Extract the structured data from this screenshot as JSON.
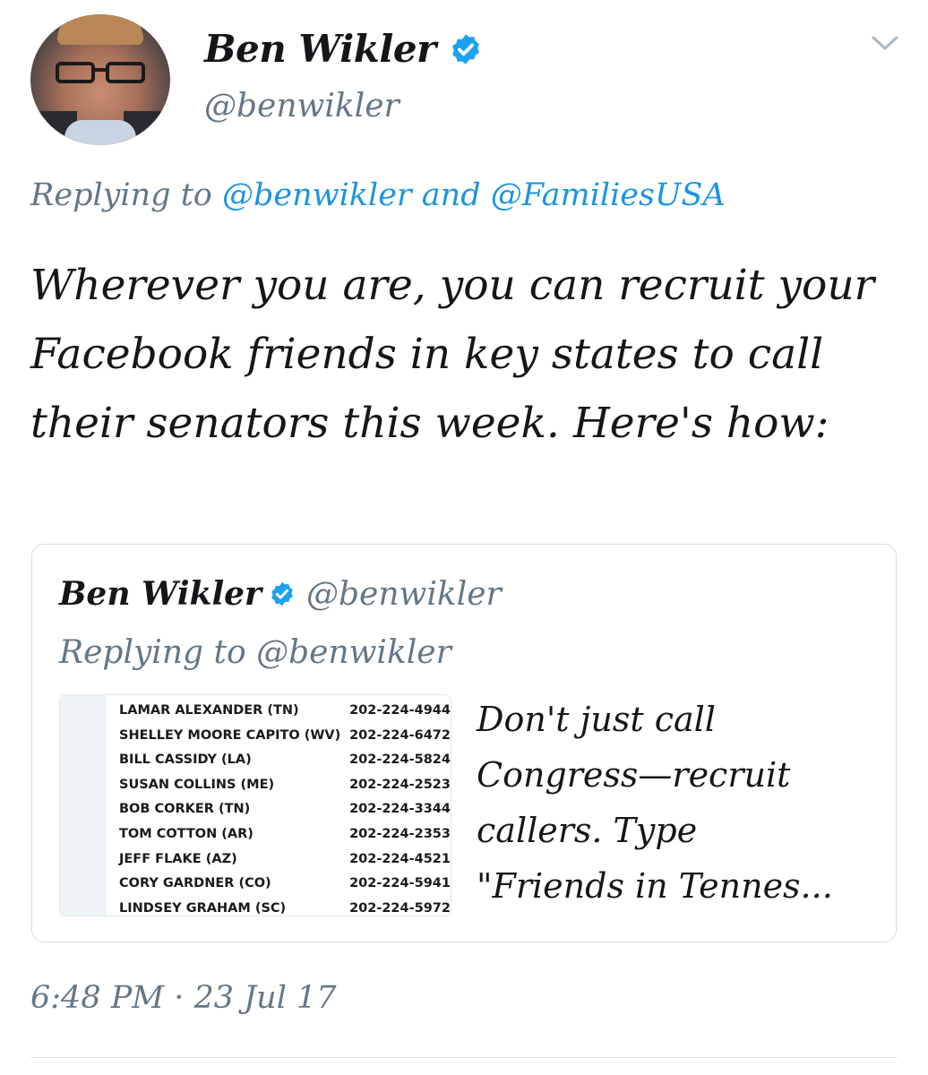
{
  "author": {
    "display_name": "Ben Wikler",
    "handle": "@benwikler"
  },
  "reply_context": {
    "prefix": "Replying to",
    "user1": "@benwikler",
    "and": "and",
    "user2": "@FamiliesUSA"
  },
  "tweet_text": "Wherever you are, you can recruit your Facebook friends in key states to call their senators this week. Here's how:",
  "quoted_tweet": {
    "display_name": "Ben Wikler",
    "handle": "@benwikler",
    "replying": "Replying to @benwikler",
    "text_lines": [
      "Don't just call",
      "Congress—recruit",
      "callers. Type",
      "\"Friends in Tennes..."
    ],
    "image_rows": [
      {
        "name": "LAMAR ALEXANDER (TN)",
        "phone": "202-224-4944"
      },
      {
        "name": "SHELLEY MOORE CAPITO (WV)",
        "phone": "202-224-6472"
      },
      {
        "name": "BILL CASSIDY (LA)",
        "phone": "202-224-5824"
      },
      {
        "name": "SUSAN COLLINS (ME)",
        "phone": "202-224-2523"
      },
      {
        "name": "BOB CORKER (TN)",
        "phone": "202-224-3344"
      },
      {
        "name": "TOM COTTON (AR)",
        "phone": "202-224-2353"
      },
      {
        "name": "JEFF FLAKE (AZ)",
        "phone": "202-224-4521"
      },
      {
        "name": "CORY GARDNER (CO)",
        "phone": "202-224-5941"
      },
      {
        "name": "LINDSEY GRAHAM (SC)",
        "phone": "202-224-5972"
      }
    ]
  },
  "timestamp": "6:48 PM · 23 Jul 17",
  "icons": {
    "verified": "verified-badge-icon",
    "menu": "chevron-down-icon"
  },
  "colors": {
    "link": "#1b95e0",
    "secondary": "#657786",
    "verified": "#1da1f2"
  }
}
